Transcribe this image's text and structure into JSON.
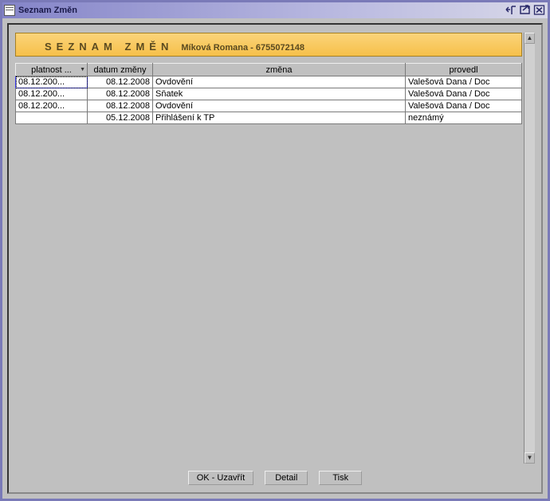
{
  "window": {
    "title": "Seznam Změn"
  },
  "banner": {
    "title": "SEZNAM ZMĚN",
    "subtitle": "Míková Romana - 6755072148"
  },
  "table": {
    "headers": {
      "platnost": "platnost ...",
      "datum": "datum změny",
      "zmena": "změna",
      "provedl": "provedl"
    },
    "rows": [
      {
        "platnost": "08.12.200...",
        "datum": "08.12.2008",
        "zmena": "Ovdovění",
        "provedl": "Valešová Dana / Doc"
      },
      {
        "platnost": "08.12.200...",
        "datum": "08.12.2008",
        "zmena": "Sňatek",
        "provedl": "Valešová Dana / Doc"
      },
      {
        "platnost": "08.12.200...",
        "datum": "08.12.2008",
        "zmena": "Ovdovění",
        "provedl": "Valešová Dana / Doc"
      },
      {
        "platnost": "",
        "datum": "05.12.2008",
        "zmena": "Přihlášení k TP",
        "provedl": "neznámý"
      }
    ]
  },
  "buttons": {
    "ok": "OK - Uzavřít",
    "detail": "Detail",
    "tisk": "Tisk"
  }
}
